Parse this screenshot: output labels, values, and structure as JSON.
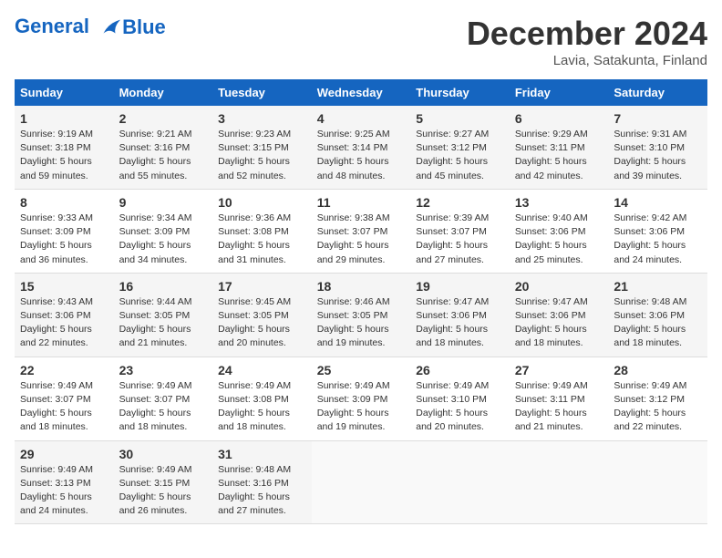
{
  "header": {
    "logo_line1": "General",
    "logo_line2": "Blue",
    "month_title": "December 2024",
    "location": "Lavia, Satakunta, Finland"
  },
  "days_of_week": [
    "Sunday",
    "Monday",
    "Tuesday",
    "Wednesday",
    "Thursday",
    "Friday",
    "Saturday"
  ],
  "weeks": [
    [
      {
        "day": "1",
        "sunrise": "9:19 AM",
        "sunset": "3:18 PM",
        "daylight": "5 hours and 59 minutes."
      },
      {
        "day": "2",
        "sunrise": "9:21 AM",
        "sunset": "3:16 PM",
        "daylight": "5 hours and 55 minutes."
      },
      {
        "day": "3",
        "sunrise": "9:23 AM",
        "sunset": "3:15 PM",
        "daylight": "5 hours and 52 minutes."
      },
      {
        "day": "4",
        "sunrise": "9:25 AM",
        "sunset": "3:14 PM",
        "daylight": "5 hours and 48 minutes."
      },
      {
        "day": "5",
        "sunrise": "9:27 AM",
        "sunset": "3:12 PM",
        "daylight": "5 hours and 45 minutes."
      },
      {
        "day": "6",
        "sunrise": "9:29 AM",
        "sunset": "3:11 PM",
        "daylight": "5 hours and 42 minutes."
      },
      {
        "day": "7",
        "sunrise": "9:31 AM",
        "sunset": "3:10 PM",
        "daylight": "5 hours and 39 minutes."
      }
    ],
    [
      {
        "day": "8",
        "sunrise": "9:33 AM",
        "sunset": "3:09 PM",
        "daylight": "5 hours and 36 minutes."
      },
      {
        "day": "9",
        "sunrise": "9:34 AM",
        "sunset": "3:09 PM",
        "daylight": "5 hours and 34 minutes."
      },
      {
        "day": "10",
        "sunrise": "9:36 AM",
        "sunset": "3:08 PM",
        "daylight": "5 hours and 31 minutes."
      },
      {
        "day": "11",
        "sunrise": "9:38 AM",
        "sunset": "3:07 PM",
        "daylight": "5 hours and 29 minutes."
      },
      {
        "day": "12",
        "sunrise": "9:39 AM",
        "sunset": "3:07 PM",
        "daylight": "5 hours and 27 minutes."
      },
      {
        "day": "13",
        "sunrise": "9:40 AM",
        "sunset": "3:06 PM",
        "daylight": "5 hours and 25 minutes."
      },
      {
        "day": "14",
        "sunrise": "9:42 AM",
        "sunset": "3:06 PM",
        "daylight": "5 hours and 24 minutes."
      }
    ],
    [
      {
        "day": "15",
        "sunrise": "9:43 AM",
        "sunset": "3:06 PM",
        "daylight": "5 hours and 22 minutes."
      },
      {
        "day": "16",
        "sunrise": "9:44 AM",
        "sunset": "3:05 PM",
        "daylight": "5 hours and 21 minutes."
      },
      {
        "day": "17",
        "sunrise": "9:45 AM",
        "sunset": "3:05 PM",
        "daylight": "5 hours and 20 minutes."
      },
      {
        "day": "18",
        "sunrise": "9:46 AM",
        "sunset": "3:05 PM",
        "daylight": "5 hours and 19 minutes."
      },
      {
        "day": "19",
        "sunrise": "9:47 AM",
        "sunset": "3:06 PM",
        "daylight": "5 hours and 18 minutes."
      },
      {
        "day": "20",
        "sunrise": "9:47 AM",
        "sunset": "3:06 PM",
        "daylight": "5 hours and 18 minutes."
      },
      {
        "day": "21",
        "sunrise": "9:48 AM",
        "sunset": "3:06 PM",
        "daylight": "5 hours and 18 minutes."
      }
    ],
    [
      {
        "day": "22",
        "sunrise": "9:49 AM",
        "sunset": "3:07 PM",
        "daylight": "5 hours and 18 minutes."
      },
      {
        "day": "23",
        "sunrise": "9:49 AM",
        "sunset": "3:07 PM",
        "daylight": "5 hours and 18 minutes."
      },
      {
        "day": "24",
        "sunrise": "9:49 AM",
        "sunset": "3:08 PM",
        "daylight": "5 hours and 18 minutes."
      },
      {
        "day": "25",
        "sunrise": "9:49 AM",
        "sunset": "3:09 PM",
        "daylight": "5 hours and 19 minutes."
      },
      {
        "day": "26",
        "sunrise": "9:49 AM",
        "sunset": "3:10 PM",
        "daylight": "5 hours and 20 minutes."
      },
      {
        "day": "27",
        "sunrise": "9:49 AM",
        "sunset": "3:11 PM",
        "daylight": "5 hours and 21 minutes."
      },
      {
        "day": "28",
        "sunrise": "9:49 AM",
        "sunset": "3:12 PM",
        "daylight": "5 hours and 22 minutes."
      }
    ],
    [
      {
        "day": "29",
        "sunrise": "9:49 AM",
        "sunset": "3:13 PM",
        "daylight": "5 hours and 24 minutes."
      },
      {
        "day": "30",
        "sunrise": "9:49 AM",
        "sunset": "3:15 PM",
        "daylight": "5 hours and 26 minutes."
      },
      {
        "day": "31",
        "sunrise": "9:48 AM",
        "sunset": "3:16 PM",
        "daylight": "5 hours and 27 minutes."
      },
      null,
      null,
      null,
      null
    ]
  ]
}
